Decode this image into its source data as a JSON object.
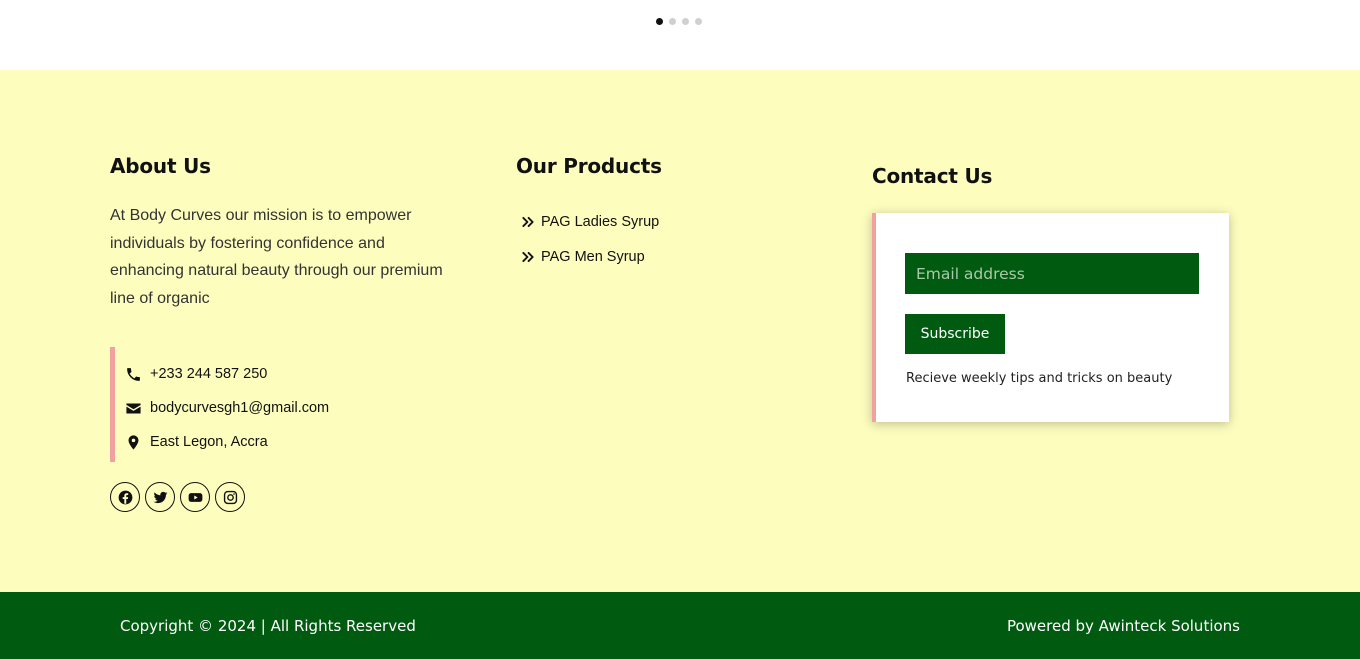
{
  "carousel": {
    "dot_count": 4,
    "active_index": 0
  },
  "about": {
    "heading": "About Us",
    "text": "At Body Curves our mission is to empower individuals by fostering confidence and enhancing natural beauty through our premium line of organic"
  },
  "contact_info": {
    "phone": "+233 244 587 250",
    "email": "bodycurvesgh1@gmail.com",
    "address": "East Legon, Accra",
    "accent_color": "#f2a1a1"
  },
  "socials": [
    {
      "icon": "facebook-icon"
    },
    {
      "icon": "twitter-icon"
    },
    {
      "icon": "youtube-icon"
    },
    {
      "icon": "instagram-icon"
    }
  ],
  "products": {
    "heading": "Our Products",
    "items": [
      {
        "label": "PAG Ladies Syrup",
        "icon": "double-chevron-right-icon"
      },
      {
        "label": "PAG Men Syrup",
        "icon": "double-chevron-right-icon"
      }
    ]
  },
  "contact": {
    "heading": "Contact Us",
    "email_placeholder": "Email address",
    "subscribe_label": "Subscribe",
    "tips": "Recieve weekly tips and tricks on beauty"
  },
  "footer": {
    "copyright": "Copyright © 2024 | All Rights Reserved",
    "powered_by": "Powered by Awinteck Solutions",
    "brand_color": "#005a10",
    "background_color": "#fdfdbe"
  }
}
